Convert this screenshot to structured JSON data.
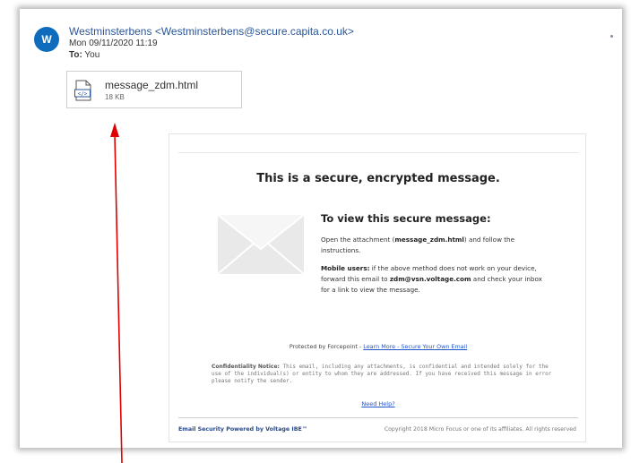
{
  "email": {
    "avatar_initial": "W",
    "sender": "Westminsterbens <Westminsterbens@secure.capita.co.uk>",
    "date": "Mon 09/11/2020 11:19",
    "to_label": "To:",
    "to_value": "You"
  },
  "attachment": {
    "name": "message_zdm.html",
    "size": "18 KB",
    "icon": "html-file-icon"
  },
  "message": {
    "headline": "This is a secure, encrypted message.",
    "view_title": "To view this secure message:",
    "open_prefix": "Open the attachment (",
    "open_file": "message_zdm.html",
    "open_suffix": ") and follow the instructions.",
    "mobile_label": "Mobile users:",
    "mobile_text_1": " if the above method does not work on your device, forward this email to ",
    "mobile_email": "zdm@vsn.voltage.com",
    "mobile_text_2": " and check your inbox for a link to view the message.",
    "protected_text": "Protected by Forcepoint - ",
    "protected_link": "Learn More - Secure Your Own Email",
    "confidential_label": "Confidentiality Notice:",
    "confidential_text": " This email, including any attachments, is confidential and intended solely for the use of the individual(s) or entity to whom they are addressed. If you have received this message in error please notify the sender.",
    "need_help": "Need Help?",
    "footer_left": "Email Security Powered by Voltage IBE™",
    "footer_right": "Copyright 2018 Micro Focus or one of its affiliates. All rights reserved"
  },
  "colors": {
    "avatar": "#0f6cbd",
    "sender": "#2b579a",
    "link": "#2255cc",
    "arrow": "#e00000"
  }
}
